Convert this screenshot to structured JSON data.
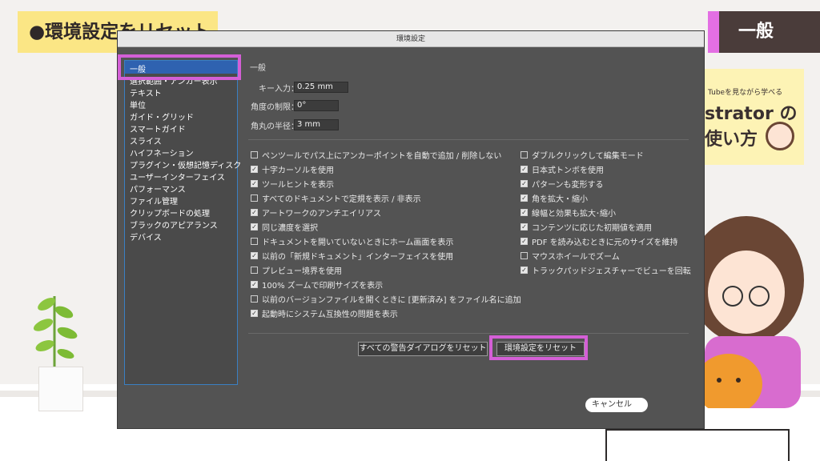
{
  "banners": {
    "title": "●環境設定をリセット",
    "section": "一般",
    "promo_sub": "Tubeを見ながら学べる",
    "promo_title1": "strator の",
    "promo_title2": "使い方"
  },
  "dialog": {
    "title": "環境設定",
    "sidebar": [
      {
        "label": "一般",
        "selected": true
      },
      {
        "label": "選択範囲・アンカー表示"
      },
      {
        "label": "テキスト"
      },
      {
        "label": "単位"
      },
      {
        "label": "ガイド・グリッド"
      },
      {
        "label": "スマートガイド"
      },
      {
        "label": "スライス"
      },
      {
        "label": "ハイフネーション"
      },
      {
        "label": "プラグイン・仮想記憶ディスク"
      },
      {
        "label": "ユーザーインターフェイス"
      },
      {
        "label": "パフォーマンス"
      },
      {
        "label": "ファイル管理"
      },
      {
        "label": "クリップボードの処理"
      },
      {
        "label": "ブラックのアピアランス"
      },
      {
        "label": "デバイス"
      }
    ],
    "section_heading": "一般",
    "fields": [
      {
        "label": "キー入力：",
        "value": "0.25 mm"
      },
      {
        "label": "角度の制限：",
        "value": "0°"
      },
      {
        "label": "角丸の半径：",
        "value": "3 mm"
      }
    ],
    "left_options": [
      {
        "label": "ペンツールでパス上にアンカーポイントを自動で追加 / 削除しない",
        "checked": false
      },
      {
        "label": "十字カーソルを使用",
        "checked": true
      },
      {
        "label": "ツールヒントを表示",
        "checked": true
      },
      {
        "label": "すべてのドキュメントで定規を表示 / 非表示",
        "checked": false
      },
      {
        "label": "アートワークのアンチエイリアス",
        "checked": true
      },
      {
        "label": "同じ濃度を選択",
        "checked": true
      },
      {
        "label": "ドキュメントを開いていないときにホーム画面を表示",
        "checked": false
      },
      {
        "label": "以前の「新規ドキュメント」インターフェイスを使用",
        "checked": true
      },
      {
        "label": "プレビュー境界を使用",
        "checked": false
      },
      {
        "label": "100% ズームで印刷サイズを表示",
        "checked": true
      },
      {
        "label": "以前のバージョンファイルを開くときに [更新済み] をファイル名に追加",
        "checked": false
      },
      {
        "label": "起動時にシステム互換性の問題を表示",
        "checked": true
      }
    ],
    "right_options": [
      {
        "label": "ダブルクリックして編集モード",
        "checked": false
      },
      {
        "label": "日本式トンボを使用",
        "checked": true
      },
      {
        "label": "パターンも変形する",
        "checked": true
      },
      {
        "label": "角を拡大・縮小",
        "checked": true
      },
      {
        "label": "線幅と効果も拡大･縮小",
        "checked": true
      },
      {
        "label": "コンテンツに応じた初期値を適用",
        "checked": true
      },
      {
        "label": "PDF を読み込むときに元のサイズを維持",
        "checked": true
      },
      {
        "label": "マウスホイールでズーム",
        "checked": false
      },
      {
        "label": "トラックパッドジェスチャーでビューを回転",
        "checked": true
      }
    ],
    "buttons": {
      "reset_warnings": "すべての警告ダイアログをリセット",
      "reset_prefs": "環境設定をリセット",
      "cancel": "キャンセル"
    }
  },
  "colors": {
    "highlight": "#d45fd6",
    "selected": "#2f62b0",
    "dialog_bg": "#535353",
    "banner_yellow": "#fbe685"
  }
}
